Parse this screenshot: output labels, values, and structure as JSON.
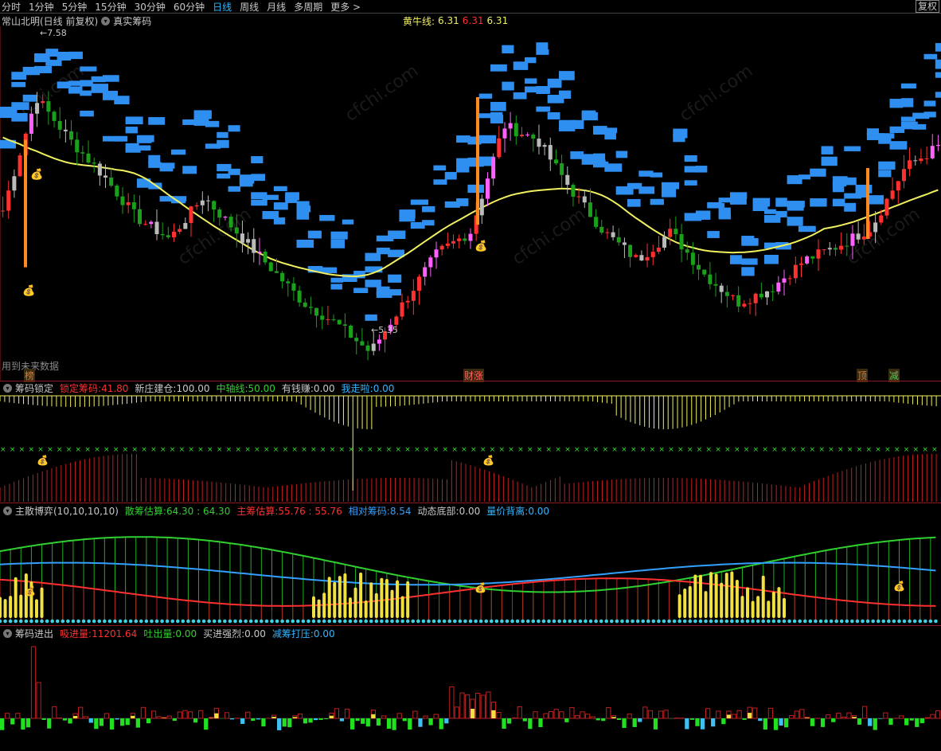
{
  "topbar": {
    "tabs": [
      "分时",
      "1分钟",
      "5分钟",
      "15分钟",
      "30分钟",
      "60分钟",
      "日线",
      "周线",
      "月线",
      "多周期",
      "更多 >"
    ],
    "active_tab": "日线",
    "fq_label": "复权"
  },
  "main": {
    "title": "常山北明(日线 前复权)",
    "indicator": "真实筹码",
    "yellow_line_label": "黄牛线:",
    "yellow_line_v1": "6.31",
    "yellow_line_v2": "6.31",
    "yellow_line_v3": "6.31",
    "high_label": "7.58",
    "low_label": "5.35",
    "future_note": "用到未来数据",
    "signals": [
      {
        "text": "榜",
        "color": "#d08040"
      },
      {
        "text": "财涨",
        "color": "#ff6060"
      },
      {
        "text": "顶",
        "color": "#d08040"
      },
      {
        "text": "减",
        "color": "#60c060"
      }
    ]
  },
  "panel2": {
    "name": "筹码锁定",
    "items": [
      {
        "label": "锁定筹码:",
        "value": "41.80",
        "color": "#ff3030"
      },
      {
        "label": "新庄建仓:",
        "value": "100.00",
        "color": "#c8c8c8"
      },
      {
        "label": "中轴线:",
        "value": "50.00",
        "color": "#30d030"
      },
      {
        "label": "有钱赚:",
        "value": "0.00",
        "color": "#c8c8c8"
      },
      {
        "label": "我走啦:",
        "value": "0.00",
        "color": "#33b5ff"
      }
    ]
  },
  "panel3": {
    "name": "主散博弈(10,10,10,10)",
    "items": [
      {
        "label": "散筹估算:",
        "value": "64.30",
        "value2": "64.30",
        "color": "#30d030"
      },
      {
        "label": "主筹估算:",
        "value": "55.76",
        "value2": "55.76",
        "color": "#ff3030"
      },
      {
        "label": "相对筹码:",
        "value": "8.54",
        "value2": "",
        "color": "#33a0ff"
      },
      {
        "label": "动态底部:",
        "value": "0.00",
        "value2": "",
        "color": "#c8c8c8"
      },
      {
        "label": "量价背离:",
        "value": "0.00",
        "value2": "",
        "color": "#33b5ff"
      }
    ]
  },
  "panel4": {
    "name": "筹码进出",
    "items": [
      {
        "label": "吸进量:",
        "value": "11201.64",
        "color": "#ff3030"
      },
      {
        "label": "吐出量:",
        "value": "0.00",
        "color": "#30d030"
      },
      {
        "label": "买进强烈:",
        "value": "0.00",
        "color": "#c8c8c8"
      },
      {
        "label": "减筹打压:",
        "value": "0.00",
        "color": "#33b5ff"
      }
    ]
  },
  "colors": {
    "up": "#ff3030",
    "down": "#1aa01a",
    "chip_blue": "#2f8ff0",
    "yellow_line": "#f0f060",
    "magenta": "#ff60ff",
    "watermark": "cfchi.com"
  },
  "chart_data": {
    "type": "candlestick",
    "ylim": [
      5.2,
      7.7
    ],
    "yellow_line_last": 6.31,
    "high": 7.58,
    "low": 5.35,
    "candles_ohlc_sampled": [
      [
        6.3,
        6.45,
        6.1,
        6.4
      ],
      [
        6.4,
        7.58,
        6.3,
        7.2
      ],
      [
        7.1,
        7.3,
        6.8,
        6.9
      ],
      [
        6.9,
        7.0,
        6.6,
        6.65
      ],
      [
        6.6,
        6.7,
        6.3,
        6.35
      ],
      [
        6.3,
        6.4,
        6.1,
        6.2
      ],
      [
        6.2,
        6.6,
        6.15,
        6.5
      ],
      [
        6.5,
        6.55,
        6.2,
        6.25
      ],
      [
        6.25,
        6.3,
        5.9,
        6.0
      ],
      [
        6.0,
        6.1,
        5.7,
        5.75
      ],
      [
        5.75,
        5.9,
        5.5,
        5.6
      ],
      [
        5.6,
        5.65,
        5.35,
        5.4
      ],
      [
        5.4,
        5.8,
        5.38,
        5.75
      ],
      [
        5.75,
        6.2,
        5.7,
        6.1
      ],
      [
        6.1,
        6.3,
        6.0,
        6.25
      ],
      [
        6.25,
        7.2,
        6.2,
        7.0
      ],
      [
        7.0,
        7.1,
        6.8,
        6.9
      ],
      [
        6.9,
        6.95,
        6.5,
        6.55
      ],
      [
        6.55,
        6.6,
        6.2,
        6.25
      ],
      [
        6.25,
        6.3,
        6.0,
        6.05
      ],
      [
        6.05,
        6.3,
        6.0,
        6.25
      ],
      [
        6.25,
        6.3,
        5.9,
        5.95
      ],
      [
        5.95,
        6.0,
        5.7,
        5.75
      ],
      [
        5.75,
        5.9,
        5.65,
        5.85
      ],
      [
        5.85,
        6.1,
        5.8,
        6.05
      ],
      [
        6.05,
        6.2,
        6.0,
        6.15
      ],
      [
        6.15,
        6.3,
        6.1,
        6.28
      ],
      [
        6.28,
        6.8,
        6.25,
        6.7
      ],
      [
        6.7,
        6.9,
        6.6,
        6.85
      ]
    ]
  }
}
